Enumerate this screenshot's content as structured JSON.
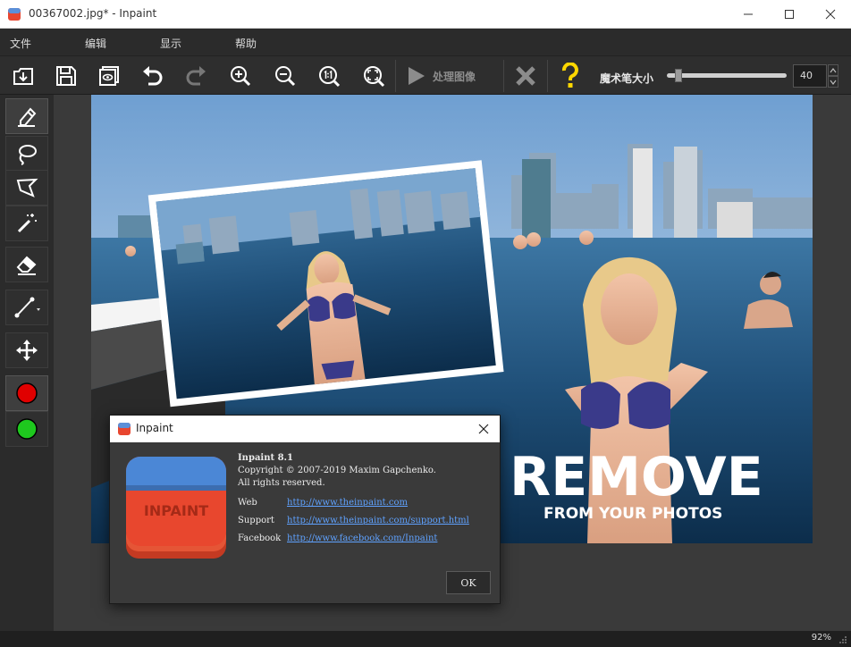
{
  "window": {
    "title": "00367002.jpg* - Inpaint"
  },
  "menu": {
    "items": [
      "文件",
      "编辑",
      "显示",
      "帮助"
    ]
  },
  "toolbar": {
    "process_label": "处理图像",
    "brush_label": "魔术笔大小",
    "brush_size": "40",
    "brush_size_fraction": 0.07
  },
  "photo": {
    "headline": "REMOVE",
    "subline": "FROM YOUR PHOTOS"
  },
  "status": {
    "zoom": "92%"
  },
  "dialog": {
    "title": "Inpaint",
    "logo_text": "INPAINT",
    "product": "Inpaint 8.1",
    "copyright": "Copyright © 2007-2019 Maxim Gapchenko.",
    "rights": "All rights reserved.",
    "rows": [
      {
        "label": "Web",
        "link": "http://www.theinpaint.com"
      },
      {
        "label": "Support",
        "link": "http://www.theinpaint.com/support.html"
      },
      {
        "label": "Facebook",
        "link": "http://www.facebook.com/Inpaint"
      }
    ],
    "ok_label": "OK"
  },
  "colors": {
    "accent_red": "#e00000",
    "accent_green": "#1ec81e",
    "help_yellow": "#ffd700",
    "link_blue": "#5fa2ff"
  }
}
